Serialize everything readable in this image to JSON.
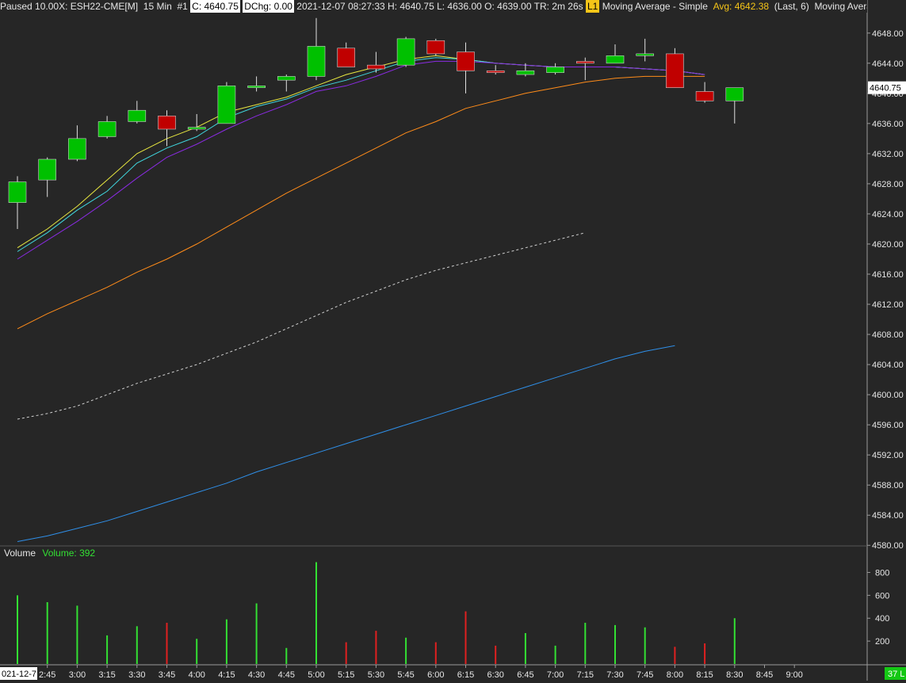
{
  "header": {
    "status": "Paused 10.00X: ESH22-CME[M]",
    "interval": "15 Min",
    "chart_id": "#1",
    "close": "C: 4640.75",
    "dchg": "DChg: 0.00",
    "bar_info": "2021-12-07 08:27:33 H: 4640.75 L: 4636.00 O: 4639.00 TR: 2m 26s",
    "level": "L1",
    "study1": "Moving Average - Simple",
    "avg": "Avg: 4642.38",
    "study_params": "(Last, 6)",
    "study2": "Moving Average - Simp"
  },
  "volume_panel": {
    "title": "Volume",
    "value": "Volume: 392"
  },
  "colors": {
    "background": "#262626",
    "up": "#00c000",
    "down": "#c00000",
    "wick": "#e0e0e0",
    "vol_up": "#33e033",
    "vol_down": "#e02020",
    "ma_yellow": "#e8e840",
    "ma_cyan": "#40d8e0",
    "ma_purple": "#8a2be2",
    "ma_orange": "#ff8c1a",
    "ma_white_dashed": "#d0d0d0",
    "ma_blue": "#2f8fe8",
    "price_box": "#ffffff",
    "date_box": "#ffffff",
    "vol_box": "#14c814"
  },
  "chart_data": [
    {
      "type": "candlestick",
      "y_ticks": [
        "4648.00",
        "4644.00",
        "4640.00",
        "4636.00",
        "4632.00",
        "4628.00",
        "4624.00",
        "4620.00",
        "4616.00",
        "4612.00",
        "4608.00",
        "4604.00",
        "4600.00",
        "4596.00",
        "4592.00",
        "4588.00",
        "4584.00",
        "4580.00"
      ],
      "ylim": [
        4579.5,
        4650.5
      ],
      "current_price_label": "4640.75",
      "current_price": 4640.75,
      "x_labels": [
        "021-12-7",
        "2:45",
        "3:00",
        "3:15",
        "3:30",
        "3:45",
        "4:00",
        "4:15",
        "4:30",
        "4:45",
        "5:00",
        "5:15",
        "5:30",
        "5:45",
        "6:00",
        "6:15",
        "6:30",
        "6:45",
        "7:00",
        "7:15",
        "7:30",
        "7:45",
        "8:00",
        "8:15",
        "8:30",
        "8:45",
        "9:00"
      ],
      "candles": [
        {
          "o": 4625.5,
          "h": 4629.0,
          "l": 4622.0,
          "c": 4628.25
        },
        {
          "o": 4628.5,
          "h": 4631.5,
          "l": 4626.25,
          "c": 4631.25
        },
        {
          "o": 4631.25,
          "h": 4635.75,
          "l": 4631.0,
          "c": 4634.0
        },
        {
          "o": 4634.25,
          "h": 4637.0,
          "l": 4634.0,
          "c": 4636.25
        },
        {
          "o": 4636.25,
          "h": 4639.0,
          "l": 4636.0,
          "c": 4637.75
        },
        {
          "o": 4637.0,
          "h": 4637.75,
          "l": 4633.0,
          "c": 4635.25
        },
        {
          "o": 4635.25,
          "h": 4637.25,
          "l": 4635.0,
          "c": 4635.5
        },
        {
          "o": 4636.0,
          "h": 4641.5,
          "l": 4636.0,
          "c": 4641.0
        },
        {
          "o": 4640.75,
          "h": 4642.25,
          "l": 4640.25,
          "c": 4641.0
        },
        {
          "o": 4641.75,
          "h": 4642.5,
          "l": 4640.25,
          "c": 4642.25
        },
        {
          "o": 4642.25,
          "h": 4650.0,
          "l": 4641.75,
          "c": 4646.25
        },
        {
          "o": 4646.0,
          "h": 4646.75,
          "l": 4643.5,
          "c": 4643.5
        },
        {
          "o": 4643.75,
          "h": 4645.5,
          "l": 4642.75,
          "c": 4643.25
        },
        {
          "o": 4643.75,
          "h": 4647.5,
          "l": 4643.5,
          "c": 4647.25
        },
        {
          "o": 4647.0,
          "h": 4647.25,
          "l": 4645.0,
          "c": 4645.25
        },
        {
          "o": 4645.5,
          "h": 4646.75,
          "l": 4640.0,
          "c": 4643.0
        },
        {
          "o": 4643.0,
          "h": 4643.75,
          "l": 4642.5,
          "c": 4642.75
        },
        {
          "o": 4642.5,
          "h": 4644.0,
          "l": 4642.25,
          "c": 4643.0
        },
        {
          "o": 4642.75,
          "h": 4644.0,
          "l": 4642.5,
          "c": 4643.5
        },
        {
          "o": 4644.25,
          "h": 4644.75,
          "l": 4641.75,
          "c": 4644.0
        },
        {
          "o": 4644.0,
          "h": 4646.5,
          "l": 4644.0,
          "c": 4645.0
        },
        {
          "o": 4645.0,
          "h": 4647.25,
          "l": 4644.25,
          "c": 4645.25
        },
        {
          "o": 4645.25,
          "h": 4646.0,
          "l": 4640.75,
          "c": 4640.75
        },
        {
          "o": 4640.25,
          "h": 4641.5,
          "l": 4638.75,
          "c": 4639.0
        },
        {
          "o": 4639.0,
          "h": 4640.75,
          "l": 4636.0,
          "c": 4640.75
        }
      ],
      "series": [
        {
          "color": "#e8e840",
          "values": [
            4619.5,
            4622.0,
            4625.0,
            4628.5,
            4632.0,
            4634.0,
            4635.5,
            4637.5,
            4638.5,
            4639.5,
            4641.0,
            4642.5,
            4643.5,
            4644.5,
            4645.0,
            4644.5,
            4644.0,
            4643.75,
            4643.5,
            4643.5,
            4643.5,
            4643.25,
            4643.0,
            4642.5
          ]
        },
        {
          "color": "#40d8e0",
          "values": [
            4619.0,
            4621.5,
            4624.5,
            4627.0,
            4630.75,
            4632.75,
            4634.25,
            4636.75,
            4638.25,
            4639.25,
            4640.75,
            4641.75,
            4643.0,
            4644.25,
            4644.75,
            4644.5,
            4644.0,
            4643.75,
            4643.5,
            4643.5,
            4643.5,
            4643.25,
            4643.0,
            4642.5
          ]
        },
        {
          "color": "#8a2be2",
          "values": [
            4618.0,
            4620.5,
            4623.0,
            4625.75,
            4628.75,
            4631.5,
            4633.25,
            4635.25,
            4637.0,
            4638.5,
            4640.25,
            4641.0,
            4642.25,
            4643.75,
            4644.25,
            4644.25,
            4644.0,
            4643.75,
            4643.5,
            4643.5,
            4643.5,
            4643.25,
            4643.0,
            4642.5
          ]
        },
        {
          "color": "#ff8c1a",
          "values": [
            4608.75,
            4610.75,
            4612.5,
            4614.25,
            4616.25,
            4618.0,
            4620.0,
            4622.25,
            4624.5,
            4626.75,
            4628.75,
            4630.75,
            4632.75,
            4634.75,
            4636.25,
            4638.0,
            4639.0,
            4640.0,
            4640.75,
            4641.5,
            4642.0,
            4642.25,
            4642.25,
            4642.25
          ]
        },
        {
          "color": "#d0d0d0",
          "dashed": true,
          "values": [
            4596.75,
            4597.5,
            4598.5,
            4600.0,
            4601.5,
            4602.75,
            4604.0,
            4605.5,
            4607.0,
            4608.75,
            4610.5,
            4612.25,
            4613.75,
            4615.25,
            4616.5,
            4617.5,
            4618.5,
            4619.5,
            4620.5,
            4621.5
          ]
        },
        {
          "color": "#2f8fe8",
          "values": [
            4580.5,
            4581.25,
            4582.25,
            4583.25,
            4584.5,
            4585.75,
            4587.0,
            4588.25,
            4589.75,
            4591.0,
            4592.25,
            4593.5,
            4594.75,
            4596.0,
            4597.25,
            4598.5,
            4599.75,
            4601.0,
            4602.25,
            4603.5,
            4604.75,
            4605.75,
            4606.5
          ]
        }
      ]
    },
    {
      "type": "bar",
      "title": "Volume",
      "y_ticks": [
        "800",
        "600",
        "400",
        "200"
      ],
      "ylim": [
        0,
        900
      ],
      "current_value_label": "37 L",
      "values": [
        600,
        540,
        510,
        250,
        330,
        360,
        220,
        390,
        530,
        140,
        890,
        190,
        290,
        230,
        190,
        460,
        160,
        270,
        160,
        360,
        340,
        320,
        150,
        180,
        400
      ],
      "up": [
        true,
        true,
        true,
        true,
        true,
        false,
        true,
        true,
        true,
        true,
        true,
        false,
        false,
        true,
        false,
        false,
        false,
        true,
        true,
        true,
        true,
        true,
        false,
        false,
        true
      ]
    }
  ]
}
